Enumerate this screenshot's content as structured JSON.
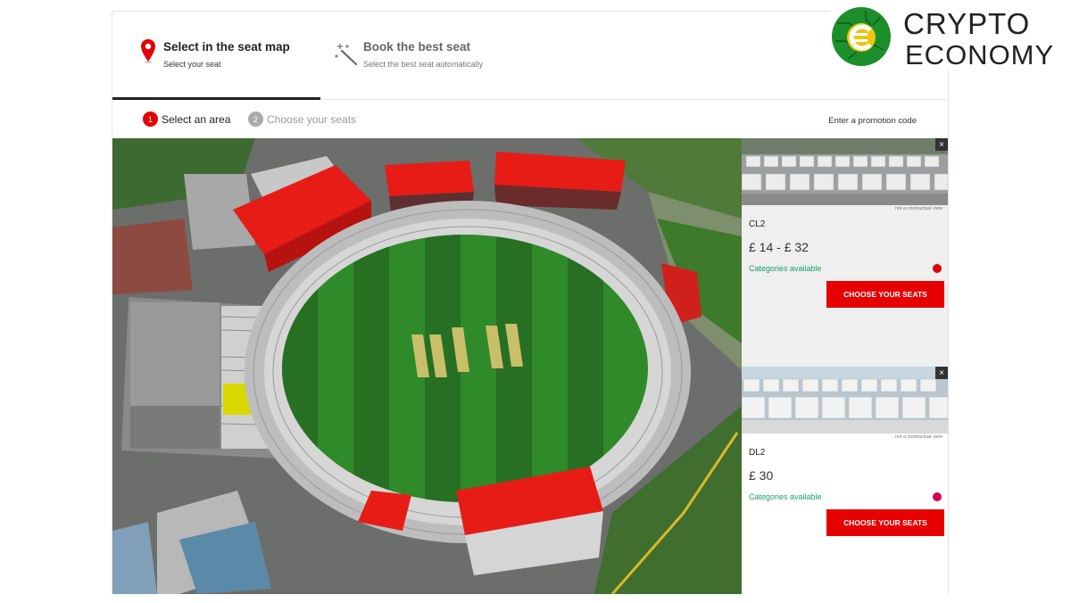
{
  "tabs": [
    {
      "title": "Select in the seat map",
      "subtitle": "Select your seat",
      "icon": "map-pin-icon"
    },
    {
      "title": "Book the best seat",
      "subtitle": "Select the best seat automatically",
      "icon": "magic-wand-icon"
    }
  ],
  "steps": [
    {
      "number": "1",
      "label": "Select an area"
    },
    {
      "number": "2",
      "label": "Choose your seats"
    }
  ],
  "promo_label": "Enter a promotion code",
  "cards": [
    {
      "name": "CL2",
      "price": "£ 14 - £ 32",
      "availability": "Categories available",
      "note": "not a contractual view",
      "button": "CHOOSE YOUR SEATS",
      "dot_color": "#e00000",
      "close": "×"
    },
    {
      "name": "DL2",
      "price": "£ 30",
      "availability": "Categories available",
      "note": "not a contractual view",
      "button": "CHOOSE YOUR SEATS",
      "dot_color": "#d6004f",
      "close": "×"
    }
  ],
  "logo": {
    "line1": "CRYPTO",
    "line2": "ECONOMY"
  },
  "colors": {
    "accent": "#e60000",
    "available": "#1aa068",
    "pitch": "#2f8a2a"
  }
}
